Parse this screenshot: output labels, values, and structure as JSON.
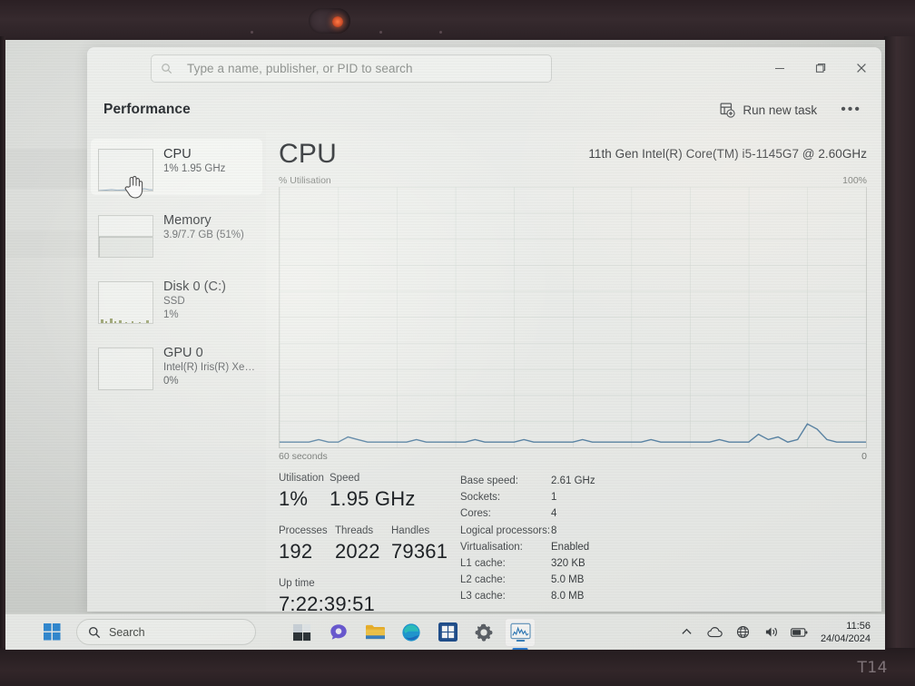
{
  "device": {
    "brand_label": "T14"
  },
  "window": {
    "page_title": "Performance",
    "search": {
      "placeholder": "Type a name, publisher, or PID to search",
      "value": "",
      "icon": "search-icon"
    },
    "controls": {
      "minimize_label": "─",
      "maximize_label": "❐",
      "close_label": "✕"
    },
    "commandbar": {
      "run_new_task_label": "Run new task",
      "run_new_task_icon": "new-window-plus-icon",
      "more_options_label": "•••"
    }
  },
  "sidebar": {
    "items": [
      {
        "name": "CPU",
        "sub": "1%  1.95 GHz",
        "selected": true,
        "thumb": "cpu-sparkline"
      },
      {
        "name": "Memory",
        "sub": "3.9/7.7 GB (51%)",
        "selected": false,
        "thumb": "memory-bar"
      },
      {
        "name": "Disk 0 (C:)",
        "sub": "SSD",
        "sub2": "1%",
        "selected": false,
        "thumb": "disk-sparkline"
      },
      {
        "name": "GPU 0",
        "sub": "Intel(R) Iris(R) Xe Grap...",
        "sub2": "0%",
        "selected": false,
        "thumb": "gpu-sparkline"
      }
    ]
  },
  "main": {
    "heading": "CPU",
    "model": "11th Gen Intel(R) Core(TM) i5-1145G7 @ 2.60GHz",
    "graph_axis_label": "% Utilisation",
    "graph_max_label": "100%",
    "graph_time_label": "60 seconds",
    "graph_zero_label": "0",
    "accent_color": "#5a86a8"
  },
  "chart_data": {
    "type": "line",
    "title": "% Utilisation",
    "xlabel": "60 seconds",
    "ylabel": "% Utilisation",
    "ylim": [
      0,
      100
    ],
    "xlim": [
      60,
      0
    ],
    "grid": true,
    "legend": false,
    "series": [
      {
        "name": "CPU Utilisation",
        "color": "#5a86a8",
        "values": [
          2,
          2,
          2,
          2,
          3,
          2,
          2,
          4,
          3,
          2,
          2,
          2,
          2,
          2,
          3,
          2,
          2,
          2,
          2,
          2,
          3,
          2,
          2,
          2,
          2,
          3,
          2,
          2,
          2,
          2,
          2,
          3,
          2,
          2,
          2,
          2,
          2,
          2,
          3,
          2,
          2,
          2,
          2,
          2,
          2,
          3,
          2,
          2,
          2,
          5,
          3,
          4,
          2,
          3,
          9,
          7,
          3,
          2,
          2,
          2,
          2
        ]
      }
    ]
  },
  "stats": {
    "left": [
      {
        "label": "Utilisation",
        "value": "1%"
      },
      {
        "label": "Speed",
        "value": "1.95 GHz"
      },
      {
        "label": "Processes",
        "value": "192"
      },
      {
        "label": "Threads",
        "value": "2022"
      },
      {
        "label": "Handles",
        "value": "79361"
      },
      {
        "label": "Up time",
        "value": "7:22:39:51"
      }
    ],
    "right": [
      {
        "key": "Base speed:",
        "value": "2.61 GHz"
      },
      {
        "key": "Sockets:",
        "value": "1"
      },
      {
        "key": "Cores:",
        "value": "4"
      },
      {
        "key": "Logical processors:",
        "value": "8"
      },
      {
        "key": "Virtualisation:",
        "value": "Enabled"
      },
      {
        "key": "L1 cache:",
        "value": "320 KB"
      },
      {
        "key": "L2 cache:",
        "value": "5.0 MB"
      },
      {
        "key": "L3 cache:",
        "value": "8.0 MB"
      }
    ]
  },
  "taskbar": {
    "start_label": "Start",
    "search_placeholder": "Search",
    "icons": [
      {
        "name": "task-view-icon",
        "label": "Task View"
      },
      {
        "name": "chat-icon",
        "label": "Chat"
      },
      {
        "name": "file-explorer-icon",
        "label": "File Explorer"
      },
      {
        "name": "edge-icon",
        "label": "Microsoft Edge"
      },
      {
        "name": "store-icon",
        "label": "Microsoft Store"
      },
      {
        "name": "settings-icon",
        "label": "Settings"
      },
      {
        "name": "task-manager-icon",
        "label": "Task Manager",
        "active": true
      }
    ],
    "tray": {
      "chevron_label": "∧",
      "onedrive_label": "OneDrive",
      "network_label": "Network",
      "volume_label": "Volume",
      "battery_label": "Battery"
    },
    "clock": {
      "time": "11:56",
      "date": "24/04/2024"
    }
  }
}
